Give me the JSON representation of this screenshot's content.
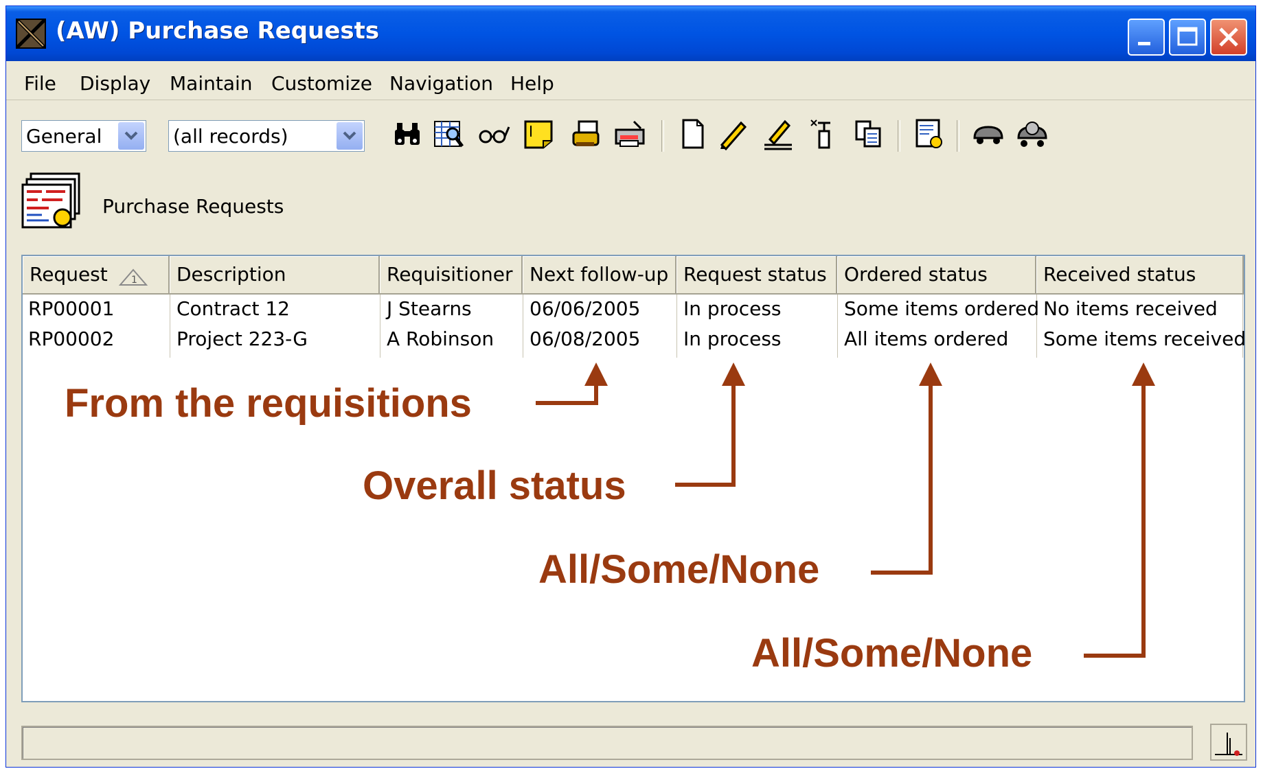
{
  "window": {
    "title": "(AW) Purchase Requests",
    "controls": [
      "minimize-icon",
      "maximize-icon",
      "close-icon"
    ]
  },
  "menu": {
    "items": [
      "File",
      "Display",
      "Maintain",
      "Customize",
      "Navigation",
      "Help"
    ]
  },
  "toolbar": {
    "view_select": "General",
    "filter_select": "(all records)",
    "icons": [
      "binoculars-icon",
      "search-grid-icon",
      "glasses-icon",
      "note-icon",
      "stamp-icon",
      "printer-icon",
      "new-document-icon",
      "pencil-icon",
      "edit-lines-icon",
      "delete-icon",
      "copy-icon",
      "settings-document-icon",
      "car-icon",
      "car-gear-icon"
    ]
  },
  "module": {
    "title": "Purchase Requests"
  },
  "table": {
    "columns": [
      "Request",
      "Description",
      "Requisitioner",
      "Next follow-up",
      "Request status",
      "Ordered status",
      "Received status"
    ],
    "sort_indicator": "1",
    "rows": [
      [
        "RP00001",
        "Contract 12",
        "J Stearns",
        "06/06/2005",
        "In process",
        "Some items ordered",
        "No items received"
      ],
      [
        "RP00002",
        "Project 223-G",
        "A Robinson",
        "06/08/2005",
        "In process",
        "All items ordered",
        "Some items received"
      ]
    ]
  },
  "annotations": [
    "From the requisitions",
    "Overall status",
    "All/Some/None",
    "All/Some/None"
  ],
  "colors": {
    "annotation": "#9a3a10",
    "titlebar": "#0054e3",
    "window_bg": "#ece9d8"
  }
}
